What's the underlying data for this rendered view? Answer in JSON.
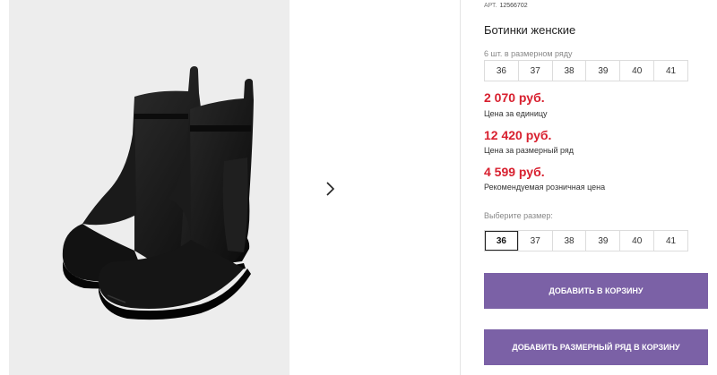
{
  "product": {
    "article_label": "АРТ.",
    "article_number": "12566702",
    "title": "Ботинки женские",
    "pack_info": "6 шт. в размерном ряду",
    "size_row": [
      "36",
      "37",
      "38",
      "39",
      "40",
      "41"
    ]
  },
  "gallery": {
    "image_icon": "boots-photo",
    "next_icon": "chevron-right-icon"
  },
  "prices": [
    {
      "value": "2 070 руб.",
      "label": "Цена за единицу"
    },
    {
      "value": "12 420 руб.",
      "label": "Цена за размерный ряд"
    },
    {
      "value": "4 599 руб.",
      "label": "Рекомендуемая розничная цена"
    }
  ],
  "size_picker": {
    "label": "Выберите размер:",
    "options": [
      "36",
      "37",
      "38",
      "39",
      "40",
      "41"
    ],
    "selected": "36"
  },
  "buttons": {
    "add_to_cart": "Добавить в корзину",
    "add_size_row": "Добавить размерный ряд в корзину"
  },
  "colors": {
    "price": "#d8202f",
    "button": "#7b61a6",
    "gallery_bg": "#ededed"
  }
}
